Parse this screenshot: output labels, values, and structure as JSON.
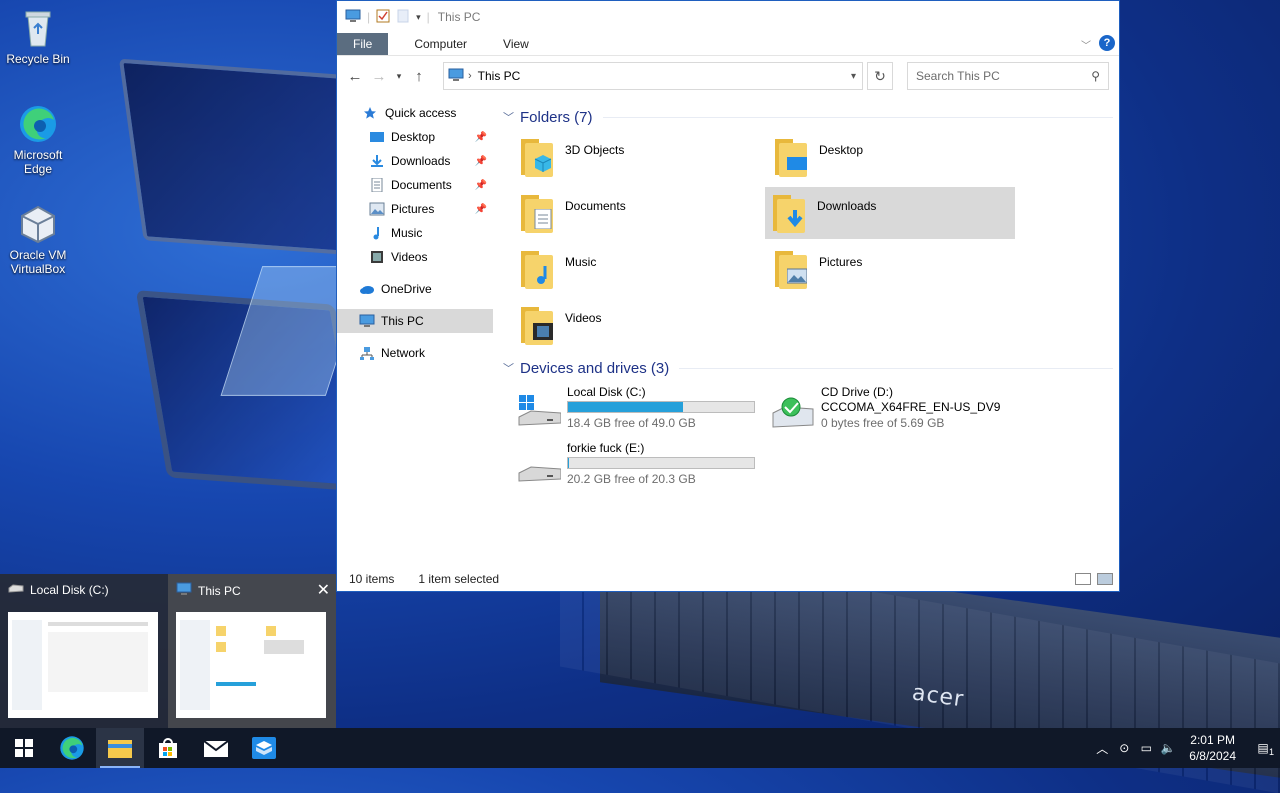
{
  "desktop": {
    "icons": [
      {
        "label": "Recycle Bin"
      },
      {
        "label": "Microsoft Edge"
      },
      {
        "label": "Oracle VM VirtualBox"
      }
    ],
    "wallpaper_brand": "acer"
  },
  "explorer": {
    "title": "This PC",
    "ribbon_tabs": [
      "File",
      "Computer",
      "View"
    ],
    "address": {
      "location": "This PC"
    },
    "search": {
      "placeholder": "Search This PC"
    },
    "nav": {
      "quick_access": "Quick access",
      "items": [
        {
          "label": "Desktop",
          "pinned": true
        },
        {
          "label": "Downloads",
          "pinned": true
        },
        {
          "label": "Documents",
          "pinned": true
        },
        {
          "label": "Pictures",
          "pinned": true
        },
        {
          "label": "Music",
          "pinned": false
        },
        {
          "label": "Videos",
          "pinned": false
        }
      ],
      "onedrive": "OneDrive",
      "this_pc": "This PC",
      "network": "Network"
    },
    "folders_header": "Folders (7)",
    "folders": [
      {
        "label": "3D Objects"
      },
      {
        "label": "Desktop"
      },
      {
        "label": "Documents"
      },
      {
        "label": "Downloads",
        "selected": true
      },
      {
        "label": "Music"
      },
      {
        "label": "Pictures"
      },
      {
        "label": "Videos"
      }
    ],
    "drives_header": "Devices and drives (3)",
    "drives": [
      {
        "name": "Local Disk (C:)",
        "free": "18.4 GB free of 49.0 GB",
        "used_fraction": 0.62
      },
      {
        "name": "CD Drive (D:)",
        "volume": "CCCOMA_X64FRE_EN-US_DV9",
        "free": "0 bytes free of 5.69 GB"
      },
      {
        "name": "forkie fuck (E:)",
        "free": "20.2 GB free of 20.3 GB",
        "used_fraction": 0.005
      }
    ],
    "status": {
      "items": "10 items",
      "selected": "1 item selected"
    }
  },
  "taskbar_preview": {
    "windows": [
      {
        "title": "Local Disk (C:)"
      },
      {
        "title": "This PC"
      }
    ]
  },
  "tray": {
    "time": "2:01 PM",
    "date": "6/8/2024",
    "notification_count": "1"
  },
  "colors": {
    "accent": "#1a66c9",
    "drive_bar": "#26a0da",
    "folder": "#f6d36b",
    "taskbar": "#101828"
  }
}
